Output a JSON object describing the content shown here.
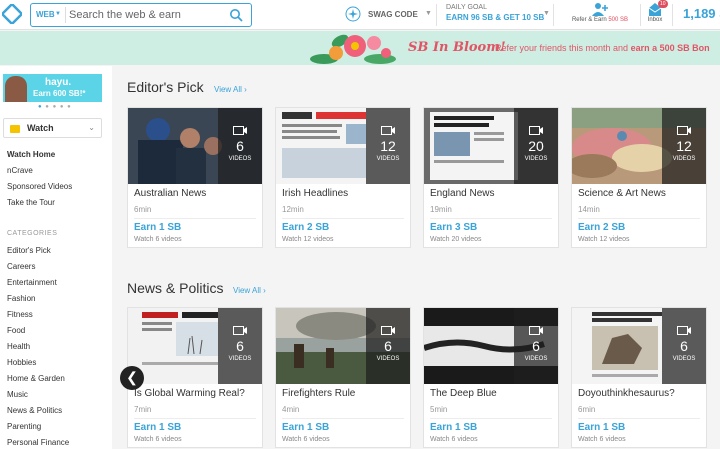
{
  "header": {
    "search": {
      "scope": "WEB",
      "placeholder": "Search the web & earn"
    },
    "swag_code_label": "SWAG CODE",
    "daily_goal": {
      "label": "DAILY GOAL",
      "value": "EARN 96 SB & GET 10 SB"
    },
    "refer": {
      "label": "Refer & Earn",
      "amount": "500 SB"
    },
    "inbox": {
      "label": "Inbox",
      "badge": "10"
    },
    "balance": "1,189 S"
  },
  "banner": {
    "title": "SB In Bloom!",
    "text_plain": "Refer your friends this month and ",
    "text_bold": "earn a 500 SB Bon"
  },
  "sidebar": {
    "ad": {
      "brand": "hayu.",
      "text": "Earn 600 SB!*"
    },
    "watch_select": "Watch",
    "nav": [
      "Watch Home",
      "nCrave",
      "Sponsored Videos",
      "Take the Tour"
    ],
    "categories_heading": "CATEGORIES",
    "categories": [
      "Editor's Pick",
      "Careers",
      "Entertainment",
      "Fashion",
      "Fitness",
      "Food",
      "Health",
      "Hobbies",
      "Home & Garden",
      "Music",
      "News & Politics",
      "Parenting",
      "Personal Finance"
    ]
  },
  "sections": [
    {
      "title": "Editor's Pick",
      "view_all": "View All",
      "cards": [
        {
          "count": "6",
          "videos_label": "VIDEOS",
          "title": "Australian News",
          "duration": "6min",
          "earn": "Earn 1 SB",
          "watch": "Watch 6 videos"
        },
        {
          "count": "12",
          "videos_label": "VIDEOS",
          "title": "Irish Headlines",
          "duration": "12min",
          "earn": "Earn 2 SB",
          "watch": "Watch 12 videos"
        },
        {
          "count": "20",
          "videos_label": "VIDEOS",
          "title": "England News",
          "duration": "19min",
          "earn": "Earn 3 SB",
          "watch": "Watch 20 videos"
        },
        {
          "count": "12",
          "videos_label": "VIDEOS",
          "title": "Science & Art News",
          "duration": "14min",
          "earn": "Earn 2 SB",
          "watch": "Watch 12 videos"
        }
      ]
    },
    {
      "title": "News & Politics",
      "view_all": "View All",
      "cards": [
        {
          "count": "6",
          "videos_label": "VIDEOS",
          "title": "Is Global Warming Real?",
          "duration": "7min",
          "earn": "Earn 1 SB",
          "watch": "Watch 6 videos"
        },
        {
          "count": "6",
          "videos_label": "VIDEOS",
          "title": "Firefighters Rule",
          "duration": "4min",
          "earn": "Earn 1 SB",
          "watch": "Watch 6 videos"
        },
        {
          "count": "6",
          "videos_label": "VIDEOS",
          "title": "The Deep Blue",
          "duration": "5min",
          "earn": "Earn 1 SB",
          "watch": "Watch 6 videos"
        },
        {
          "count": "6",
          "videos_label": "VIDEOS",
          "title": "Doyouthinkhesaurus?",
          "duration": "6min",
          "earn": "Earn 1 SB",
          "watch": "Watch 6 videos"
        }
      ]
    }
  ],
  "colors": {
    "accent": "#3aa3d8",
    "promo": "#e05566",
    "banner_bg": "#cfeee3"
  },
  "icons": [
    "logo-icon",
    "search-icon",
    "swag-code-icon",
    "refer-icon",
    "inbox-icon",
    "video-icon",
    "chevron-left-icon"
  ]
}
